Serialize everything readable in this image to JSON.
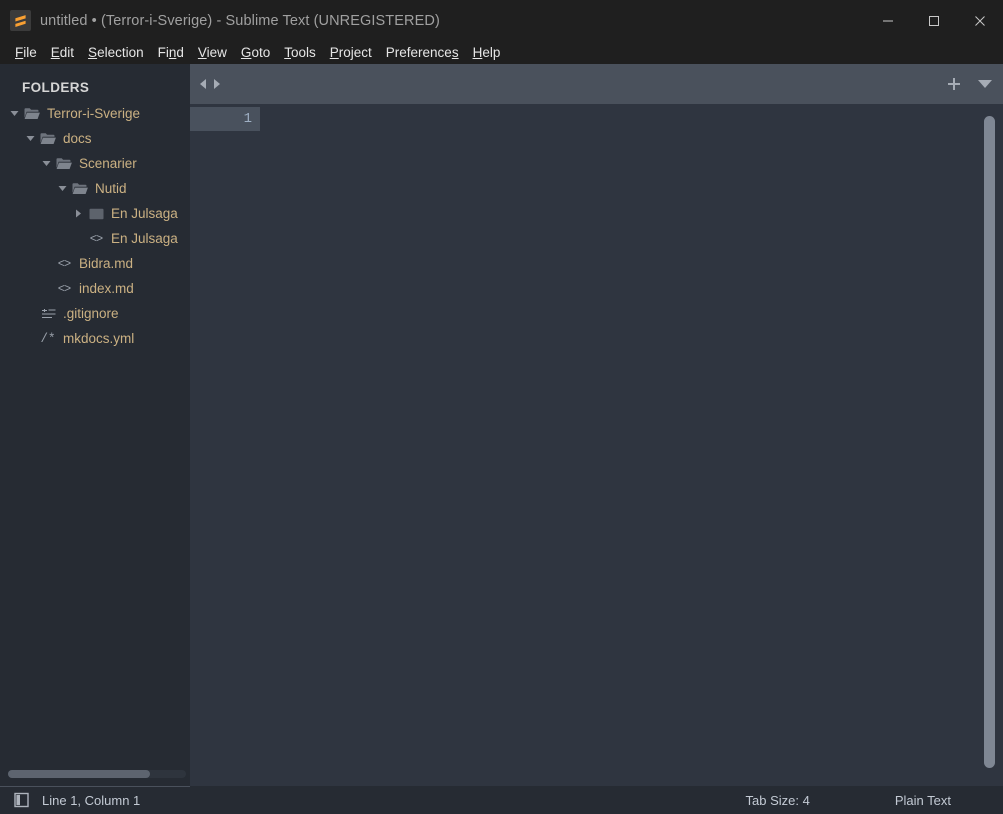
{
  "window": {
    "title": "untitled • (Terror-i-Sverige) - Sublime Text (UNREGISTERED)",
    "logo_icon": "sublime-text-logo-icon",
    "minimize_icon": "minimize-icon",
    "maximize_icon": "maximize-icon",
    "close_icon": "close-icon"
  },
  "menubar": {
    "items": [
      {
        "label": "File",
        "mnemonic_index": 0
      },
      {
        "label": "Edit",
        "mnemonic_index": 0
      },
      {
        "label": "Selection",
        "mnemonic_index": 0
      },
      {
        "label": "Find",
        "mnemonic_index": 2
      },
      {
        "label": "View",
        "mnemonic_index": 0
      },
      {
        "label": "Goto",
        "mnemonic_index": 0
      },
      {
        "label": "Tools",
        "mnemonic_index": 0
      },
      {
        "label": "Project",
        "mnemonic_index": 0
      },
      {
        "label": "Preferences",
        "mnemonic_index": 9
      },
      {
        "label": "Help",
        "mnemonic_index": 0
      }
    ]
  },
  "sidebar": {
    "header": "FOLDERS",
    "tree": [
      {
        "label": "Terror-i-Sverige",
        "type": "folder",
        "open": true,
        "depth": 0,
        "icon": "folder-open-icon",
        "arrow": "chevron-down-icon"
      },
      {
        "label": "docs",
        "type": "folder",
        "open": true,
        "depth": 1,
        "icon": "folder-open-icon",
        "arrow": "chevron-down-icon"
      },
      {
        "label": "Scenarier",
        "type": "folder",
        "open": true,
        "depth": 2,
        "icon": "folder-open-icon",
        "arrow": "chevron-down-icon"
      },
      {
        "label": "Nutid",
        "type": "folder",
        "open": true,
        "depth": 3,
        "icon": "folder-open-icon",
        "arrow": "chevron-down-icon"
      },
      {
        "label": "En Julsaga",
        "type": "folder",
        "open": false,
        "depth": 4,
        "icon": "folder-closed-icon",
        "arrow": "chevron-right-icon"
      },
      {
        "label": "En Julsaga",
        "type": "file",
        "depth": 4,
        "icon": "code-file-icon",
        "arrow": "none"
      },
      {
        "label": "Bidra.md",
        "type": "file",
        "depth": 2,
        "icon": "code-file-icon",
        "arrow": "none"
      },
      {
        "label": "index.md",
        "type": "file",
        "depth": 2,
        "icon": "code-file-icon",
        "arrow": "none"
      },
      {
        "label": ".gitignore",
        "type": "file",
        "depth": 1,
        "icon": "text-lines-icon",
        "arrow": "none"
      },
      {
        "label": "mkdocs.yml",
        "type": "file",
        "depth": 1,
        "icon": "comment-file-icon",
        "arrow": "none"
      }
    ],
    "scrollbar": "horizontal-scrollbar"
  },
  "tabbar": {
    "nav_prev_icon": "arrow-left-icon",
    "nav_next_icon": "arrow-right-icon",
    "new_tab_icon": "plus-icon",
    "tab_menu_icon": "chevron-down-icon"
  },
  "editor": {
    "line_numbers": [
      "1"
    ],
    "content": "",
    "vertical_scrollbar": "vertical-scrollbar"
  },
  "statusbar": {
    "sidebar_toggle_icon": "sidebar-toggle-icon",
    "cursor_position": "Line 1, Column 1",
    "tab_size": "Tab Size: 4",
    "syntax": "Plain Text"
  },
  "colors": {
    "titlebar_bg": "#1f1f1f",
    "sidebar_bg": "#262b33",
    "tabbar_bg": "#4a515c",
    "editor_bg": "#2f3540",
    "statusbar_bg": "#262b33",
    "accent_orange": "#f9a032",
    "tree_text": "#cbb183",
    "linenum_text": "#9fb0c4"
  }
}
